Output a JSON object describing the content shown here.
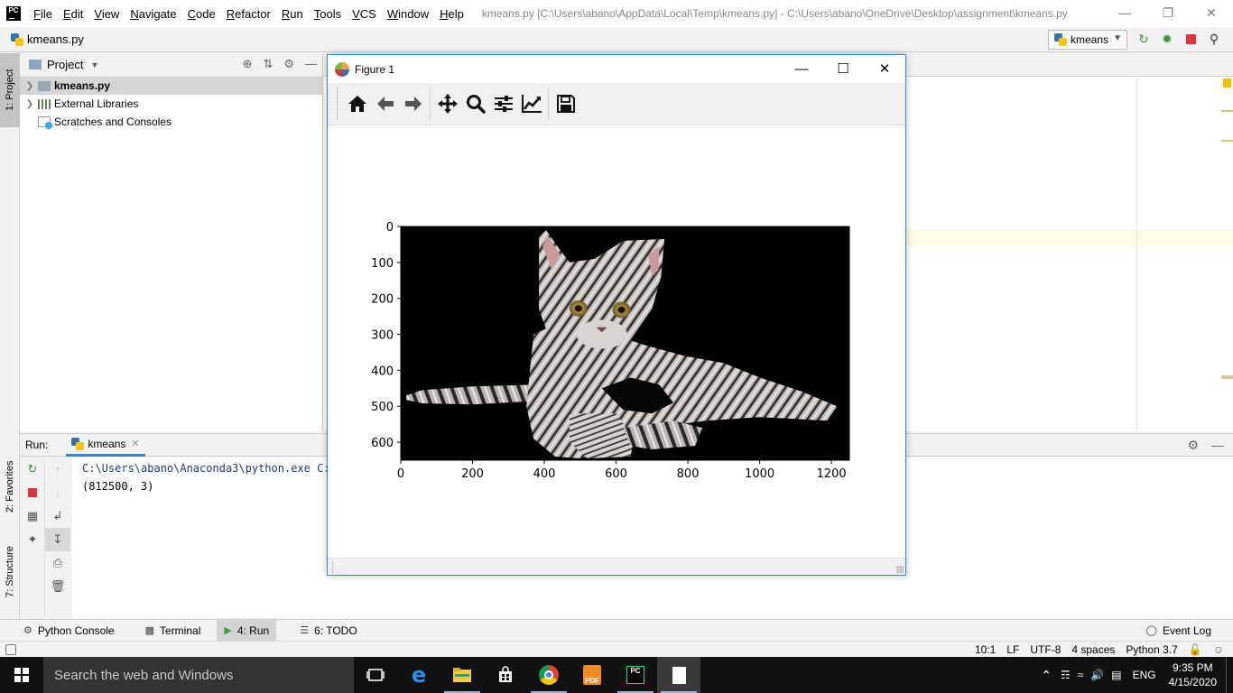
{
  "ide": {
    "logo": "PC",
    "menu": [
      "File",
      "Edit",
      "View",
      "Navigate",
      "Code",
      "Refactor",
      "Run",
      "Tools",
      "VCS",
      "Window",
      "Help"
    ],
    "window_title": "kmeans.py [C:\\Users\\abano\\AppData\\Local\\Temp\\kmeans.py] - C:\\Users\\abano\\OneDrive\\Desktop\\assignment\\kmeans.py",
    "nav_file": "kmeans.py",
    "run_config": "kmeans"
  },
  "side_tabs": {
    "project": "1: Project",
    "favorites": "2: Favorites",
    "structure": "7: Structure"
  },
  "project_panel": {
    "title": "Project",
    "items": [
      {
        "label": "kmeans.py",
        "icon": "python-file-icon"
      },
      {
        "label": "External Libraries",
        "icon": "library-icon"
      },
      {
        "label": "Scratches and Consoles",
        "icon": "scratches-icon"
      }
    ]
  },
  "run_panel": {
    "label": "Run:",
    "tab": "kmeans",
    "console_lines": [
      "C:\\Users\\abano\\Anaconda3\\python.exe C:/",
      "(812500, 3)"
    ]
  },
  "bottom_tabs": {
    "python_console": "Python Console",
    "terminal": "Terminal",
    "run": "4: Run",
    "todo": "6: TODO",
    "event_log": "Event Log"
  },
  "status_bar": {
    "position": "10:1",
    "line_sep": "LF",
    "encoding": "UTF-8",
    "indent": "4 spaces",
    "interpreter": "Python 3.7"
  },
  "figure_window": {
    "title": "Figure 1",
    "toolbar": [
      "home-icon",
      "back-icon",
      "forward-icon",
      "pan-icon",
      "zoom-icon",
      "configure-subplots-icon",
      "edit-axes-icon",
      "save-icon"
    ]
  },
  "chart_data": {
    "type": "image",
    "content": "cat photo on black background (k-means segmented)",
    "x_ticks": [
      0,
      200,
      400,
      600,
      800,
      1000,
      1200
    ],
    "y_ticks": [
      0,
      100,
      200,
      300,
      400,
      500,
      600
    ],
    "xlim": [
      0,
      1250
    ],
    "ylim": [
      650,
      0
    ],
    "image_shape": [
      650,
      1250,
      3
    ]
  },
  "taskbar": {
    "search_placeholder": "Search the web and Windows",
    "language": "ENG",
    "time": "9:35 PM",
    "date": "4/15/2020"
  },
  "colors": {
    "accent": "#4083c9",
    "window_border": "#3c86c8",
    "taskbar": "#111111"
  }
}
